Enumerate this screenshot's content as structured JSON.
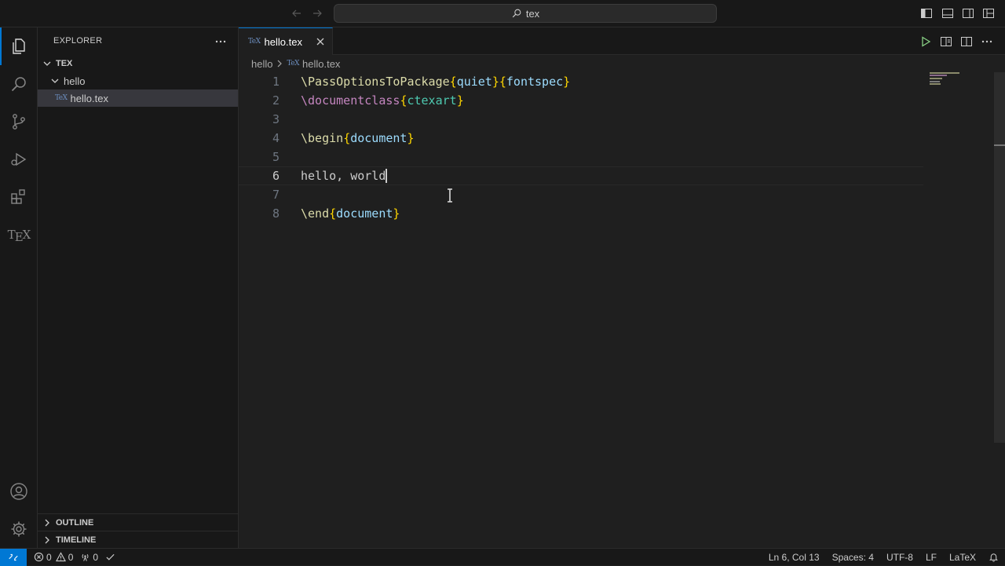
{
  "titlebar": {
    "search_text": "tex"
  },
  "sidebar": {
    "title": "EXPLORER",
    "root": "TEX",
    "folder": "hello",
    "file": "hello.tex",
    "outline": "OUTLINE",
    "timeline": "TIMELINE"
  },
  "editor": {
    "tab": "hello.tex",
    "breadcrumb": {
      "folder": "hello",
      "file": "hello.tex"
    },
    "lines": [
      {
        "n": "1"
      },
      {
        "n": "2"
      },
      {
        "n": "3"
      },
      {
        "n": "4"
      },
      {
        "n": "5"
      },
      {
        "n": "6"
      },
      {
        "n": "7"
      },
      {
        "n": "8"
      }
    ],
    "code": {
      "l1_cmd": "\\PassOptionsToPackage",
      "l1_a": "quiet",
      "l1_b": "fontspec",
      "l2_cmd": "\\documentclass",
      "l2_a": "ctexart",
      "l4_cmd": "\\begin",
      "l4_a": "document",
      "l6_text": "hello, world",
      "l8_cmd": "\\end",
      "l8_a": "document"
    },
    "current_line": 6
  },
  "statusbar": {
    "errors": "0",
    "warnings": "0",
    "ports": "0",
    "position": "Ln 6, Col 13",
    "spaces": "Spaces: 4",
    "encoding": "UTF-8",
    "eol": "LF",
    "language": "LaTeX"
  },
  "colors": {
    "accent": "#0078d4",
    "cmd_yellow": "#dcdcaa",
    "cmd_purple": "#c586c0",
    "brace": "#ffd700",
    "arg_teal": "#4ec9b0",
    "arg_blue": "#9cdcfe"
  }
}
